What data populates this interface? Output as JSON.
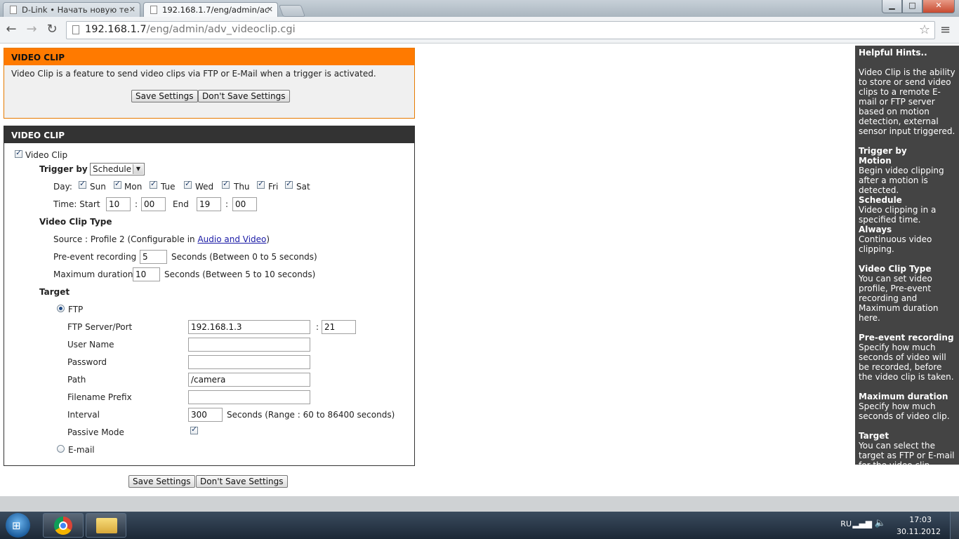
{
  "browser": {
    "tabs": [
      {
        "label": "D-Link • Начать новую те",
        "active": false
      },
      {
        "label": "192.168.1.7/eng/admin/ac",
        "active": true
      }
    ],
    "url_host": "192.168.1.7",
    "url_path": "/eng/admin/adv_videoclip.cgi",
    "window_controls": {
      "minimize": "▁",
      "maximize": "□",
      "close": "✕"
    }
  },
  "top_panel": {
    "title": "VIDEO CLIP",
    "description": "Video Clip is a feature to send video clips via FTP or E-Mail when a trigger is activated.",
    "save_label": "Save Settings",
    "dont_save_label": "Don't Save Settings"
  },
  "main_panel": {
    "title": "VIDEO CLIP",
    "enable_label": "Video Clip",
    "enable_checked": true,
    "trigger_label": "Trigger by",
    "trigger_value": "Schedule",
    "day_label": "Day:",
    "days": [
      {
        "label": "Sun",
        "checked": true
      },
      {
        "label": "Mon",
        "checked": true
      },
      {
        "label": "Tue",
        "checked": true
      },
      {
        "label": "Wed",
        "checked": true
      },
      {
        "label": "Thu",
        "checked": true
      },
      {
        "label": "Fri",
        "checked": true
      },
      {
        "label": "Sat",
        "checked": true
      }
    ],
    "time_label": "Time: Start",
    "start_hour": "10",
    "start_min": "00",
    "end_label": "End",
    "end_hour": "19",
    "end_min": "00",
    "colon": ":",
    "clip_type_heading": "Video Clip Type",
    "source_text": "Source : Profile 2  (Configurable in",
    "source_link": "Audio and Video",
    "source_close": ")",
    "pre_event_label": "Pre-event recording :",
    "pre_event_value": "5",
    "pre_event_hint": "Seconds  (Between 0 to 5 seconds)",
    "max_duration_label": "Maximum duration :",
    "max_duration_value": "10",
    "max_duration_hint": "Seconds  (Between 5 to 10 seconds)",
    "target_heading": "Target",
    "ftp_label": "FTP",
    "ftp_selected": true,
    "ftp_server_label": "FTP Server/Port",
    "ftp_server_value": "192.168.1.3",
    "ftp_port_value": "21",
    "user_name_label": "User Name",
    "user_name_value": "",
    "password_label": "Password",
    "password_value": "",
    "path_label": "Path",
    "path_value": "/camera",
    "filename_prefix_label": "Filename Prefix",
    "filename_prefix_value": "",
    "interval_label": "Interval",
    "interval_value": "300",
    "interval_hint": "Seconds  (Range : 60 to 86400 seconds)",
    "passive_label": "Passive Mode",
    "passive_checked": true,
    "email_label": "E-mail",
    "email_selected": false
  },
  "bottom_buttons": {
    "save_label": "Save Settings",
    "dont_save_label": "Don't Save Settings"
  },
  "hints": {
    "title": "Helpful Hints..",
    "intro": "Video Clip is the ability to store or send video clips to a remote E-mail or FTP server based on motion detection, external sensor input triggered.",
    "trigger_heading": "Trigger by",
    "motion_heading": "Motion",
    "motion_text": "Begin video clipping after a motion is detected.",
    "schedule_heading": "Schedule",
    "schedule_text": "Video clipping in a specified time.",
    "always_heading": "Always",
    "always_text": "Continuous video clipping.",
    "clip_type_heading": "Video Clip Type",
    "clip_type_text": "You can set video profile, Pre-event recording and Maximum duration here.",
    "pre_event_heading": "Pre-event recording",
    "pre_event_text": "Specify how much seconds of video will be recorded, before the video clip is taken.",
    "max_duration_heading": "Maximum duration",
    "max_duration_text": "Specify how much seconds of video clip.",
    "target_heading": "Target",
    "target_text": "You can select the target as FTP or E-mail for the video clip."
  },
  "taskbar": {
    "language": "RU",
    "time": "17:03",
    "date": "30.11.2012"
  }
}
